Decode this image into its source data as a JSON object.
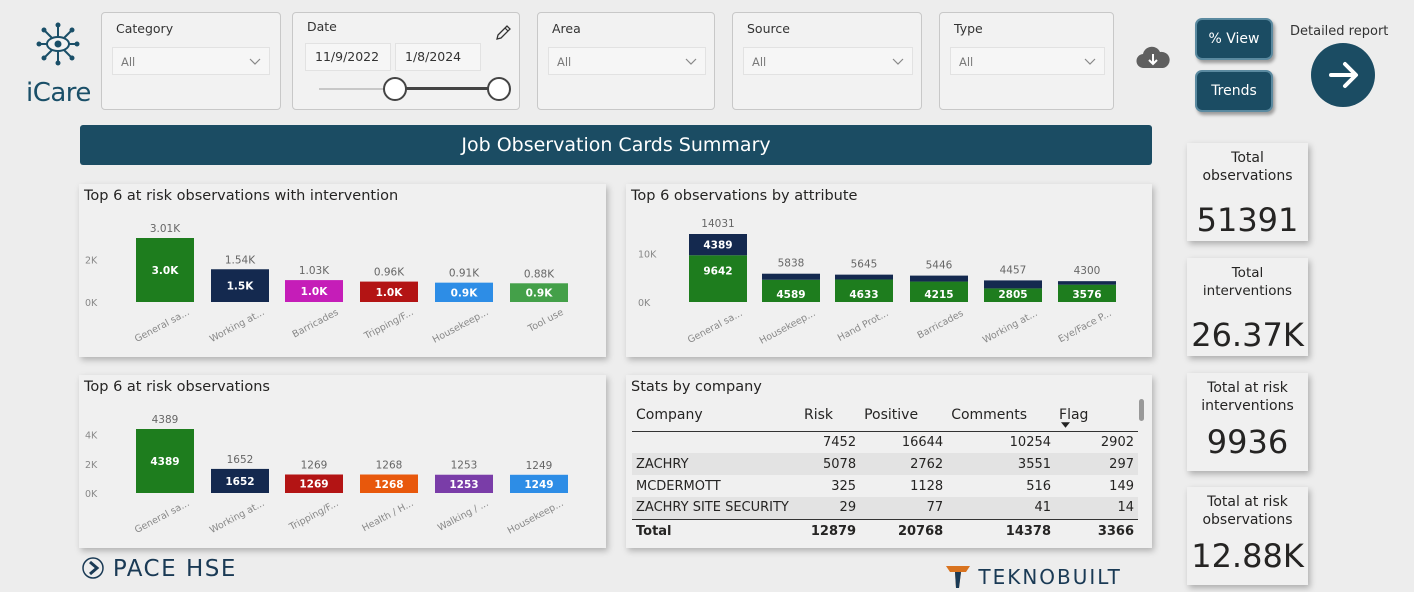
{
  "app": {
    "logo_text": "iCare",
    "logo_icon": "network-eye-icon"
  },
  "filters": {
    "category": {
      "label": "Category",
      "value": "All"
    },
    "date": {
      "label": "Date",
      "start": "11/9/2022",
      "end": "1/8/2024",
      "edit_icon": "pencil-icon"
    },
    "area": {
      "label": "Area",
      "value": "All"
    },
    "source": {
      "label": "Source",
      "value": "All"
    },
    "type": {
      "label": "Type",
      "value": "All"
    }
  },
  "toolbar": {
    "download_icon": "cloud-download-icon",
    "pct_view_label": "% View",
    "trends_label": "Trends",
    "detailed_report_label": "Detailed report",
    "detailed_report_icon": "arrow-right-icon"
  },
  "title": "Job Observation Cards Summary",
  "colors": {
    "navy": "#1b4c63",
    "dark_navy": "#14294f",
    "green": "#1e7d1e",
    "magenta": "#c51db8",
    "red": "#b31414",
    "blue": "#2d8de6",
    "light_green": "#44a049",
    "orange": "#e8580c",
    "purple": "#7a3da8"
  },
  "kpis": [
    {
      "label": "Total observations",
      "value": "51391"
    },
    {
      "label": "Total interventions",
      "value": "26.37K"
    },
    {
      "label": "Total at risk interventions",
      "value": "9936"
    },
    {
      "label": "Total at risk observations",
      "value": "12.88K"
    }
  ],
  "charts": {
    "intervention": {
      "title": "Top 6 at risk observations with intervention"
    },
    "attribute": {
      "title": "Top 6 observations by attribute"
    },
    "risk": {
      "title": "Top 6 at risk observations"
    }
  },
  "chart_data": [
    {
      "type": "bar",
      "title": "Top 6 at risk observations with intervention",
      "categories": [
        "General sa...",
        "Working at...",
        "Barricades",
        "Tripping/F...",
        "Housekeep...",
        "Tool use"
      ],
      "values": [
        3010,
        1540,
        1030,
        960,
        910,
        880
      ],
      "top_labels": [
        "3.01K",
        "1.54K",
        "1.03K",
        "0.96K",
        "0.91K",
        "0.88K"
      ],
      "inner_labels": [
        "3.0K",
        "1.5K",
        "1.0K",
        "1.0K",
        "0.9K",
        "0.9K"
      ],
      "bar_colors": [
        "#1e7d1e",
        "#14294f",
        "#c51db8",
        "#b31414",
        "#2d8de6",
        "#44a049"
      ],
      "y_ticks": [
        "0K",
        "2K"
      ],
      "ylim": [
        0,
        3010
      ]
    },
    {
      "type": "bar",
      "stacked": true,
      "title": "Top 6 observations by attribute",
      "categories": [
        "General sa...",
        "Housekeep...",
        "Hand Prot...",
        "Barricades",
        "Working at...",
        "Eye/Face P..."
      ],
      "totals": [
        14031,
        5838,
        5645,
        5446,
        4457,
        4300
      ],
      "series": [
        {
          "color": "#1e7d1e",
          "values": [
            9642,
            4589,
            4633,
            4215,
            2805,
            3576
          ]
        },
        {
          "color": "#14294f",
          "values": [
            4389,
            1249,
            1012,
            1231,
            1652,
            724
          ]
        }
      ],
      "y_ticks": [
        "0K",
        "10K"
      ],
      "ylim": [
        0,
        14031
      ]
    },
    {
      "type": "bar",
      "title": "Top 6 at risk observations",
      "categories": [
        "General sa...",
        "Working at...",
        "Tripping/F...",
        "Health / H...",
        "Walking / ...",
        "Housekeep..."
      ],
      "values": [
        4389,
        1652,
        1269,
        1268,
        1253,
        1249
      ],
      "bar_colors": [
        "#1e7d1e",
        "#14294f",
        "#b31414",
        "#e8580c",
        "#7a3da8",
        "#2d8de6"
      ],
      "y_ticks": [
        "0K",
        "2K",
        "4K"
      ],
      "ylim": [
        0,
        4389
      ]
    }
  ],
  "stats": {
    "title": "Stats by company",
    "columns": [
      "Company",
      "Risk",
      "Positive",
      "Comments",
      "Flag"
    ],
    "rows": [
      [
        "",
        "7452",
        "16644",
        "10254",
        "2902"
      ],
      [
        "ZACHRY",
        "5078",
        "2762",
        "3551",
        "297"
      ],
      [
        "MCDERMOTT",
        "325",
        "1128",
        "516",
        "149"
      ],
      [
        "ZACHRY SITE SECURITY",
        "29",
        "77",
        "41",
        "14"
      ]
    ],
    "total": [
      "Total",
      "12879",
      "20768",
      "14378",
      "3366"
    ]
  },
  "footer": {
    "left_brand": "PACE HSE",
    "right_brand": "TEKNOBUILT"
  }
}
